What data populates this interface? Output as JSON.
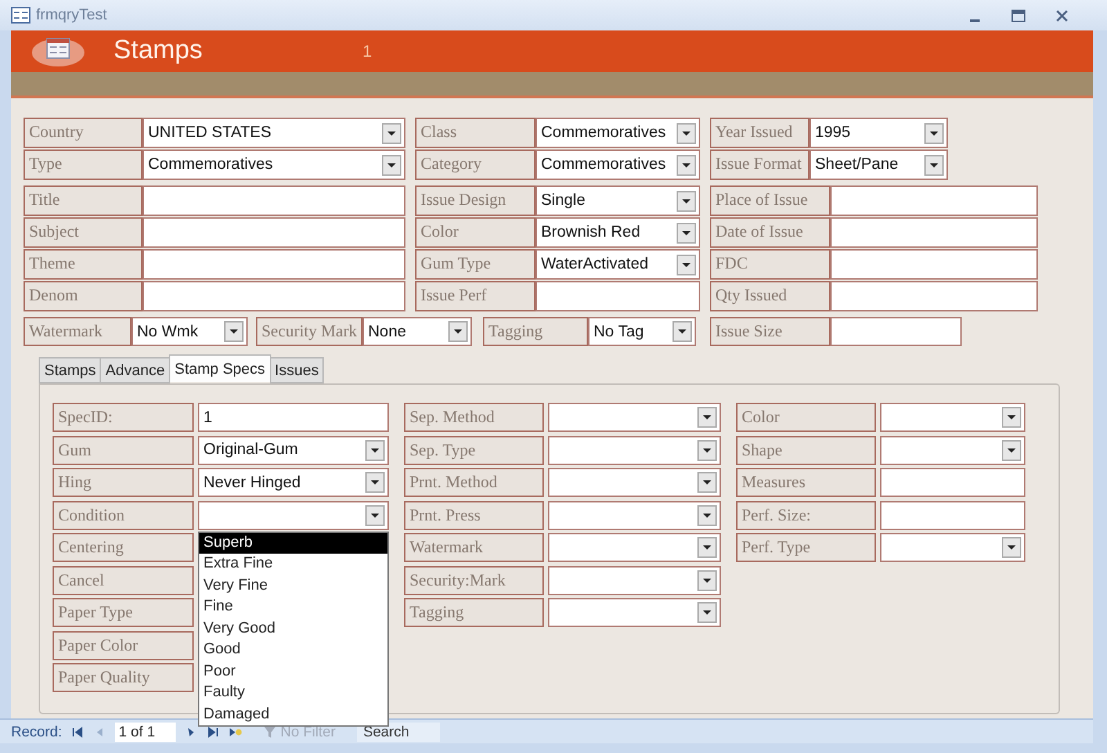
{
  "window": {
    "title": "frmqryTest"
  },
  "header": {
    "title": "Stamps",
    "record_number": "1"
  },
  "top_rows": [
    {
      "fields": [
        {
          "label": "Country",
          "value": "UNITED STATES",
          "kind": "combo"
        },
        {
          "label": "Class",
          "value": "Commemoratives",
          "kind": "combo"
        },
        {
          "label": "Year Issued",
          "value": "1995",
          "kind": "combo"
        }
      ]
    },
    {
      "fields": [
        {
          "label": "Type",
          "value": "Commemoratives",
          "kind": "combo"
        },
        {
          "label": "Category",
          "value": "Commemoratives",
          "kind": "combo"
        },
        {
          "label": "Issue Format",
          "value": "Sheet/Pane",
          "kind": "combo"
        }
      ]
    }
  ],
  "mid_rows": [
    {
      "fields": [
        {
          "label": "Title",
          "kind": "text"
        },
        {
          "label": "Issue Design",
          "value": "Single",
          "kind": "combo"
        },
        {
          "label": "Place of Issue",
          "kind": "text"
        }
      ]
    },
    {
      "fields": [
        {
          "label": "Subject",
          "kind": "text"
        },
        {
          "label": "Color",
          "value": "Brownish Red",
          "kind": "combo"
        },
        {
          "label": "Date of Issue",
          "kind": "text"
        }
      ]
    },
    {
      "fields": [
        {
          "label": "Theme",
          "kind": "text"
        },
        {
          "label": "Gum Type",
          "value": "WaterActivated",
          "kind": "combo"
        },
        {
          "label": "FDC",
          "kind": "text"
        }
      ]
    },
    {
      "fields": [
        {
          "label": "Denom",
          "kind": "text"
        },
        {
          "label": "Issue Perf",
          "kind": "text"
        },
        {
          "label": "Qty Issued",
          "kind": "text"
        }
      ]
    }
  ],
  "bottom_row": [
    {
      "label": "Watermark",
      "value": "No Wmk",
      "kind": "combo"
    },
    {
      "label": "Security Mark",
      "value": "None",
      "kind": "combo"
    },
    {
      "label": "Tagging",
      "value": "No Tag",
      "kind": "combo"
    },
    {
      "label": "Issue Size",
      "kind": "text"
    }
  ],
  "tabs": [
    {
      "label": "Stamps",
      "selected": false
    },
    {
      "label": "Advance",
      "selected": false
    },
    {
      "label": "Stamp Specs",
      "selected": true
    },
    {
      "label": "Issues",
      "selected": false
    }
  ],
  "spec_columns": [
    {
      "fields": [
        {
          "label": "SpecID:",
          "value": "1",
          "kind": "text"
        },
        {
          "label": "Gum",
          "value": "Original-Gum",
          "kind": "combo"
        },
        {
          "label": "Hing",
          "value": "Never Hinged",
          "kind": "combo"
        },
        {
          "label": "Condition",
          "kind": "combo",
          "open": true,
          "options": [
            {
              "label": "Superb",
              "selected": true
            },
            {
              "label": "Extra Fine",
              "selected": false
            },
            {
              "label": "Very Fine",
              "selected": false
            },
            {
              "label": "Fine",
              "selected": false
            },
            {
              "label": "Very Good",
              "selected": false
            },
            {
              "label": "Good",
              "selected": false
            },
            {
              "label": "Poor",
              "selected": false
            },
            {
              "label": "Faulty",
              "selected": false
            },
            {
              "label": "Damaged",
              "selected": false
            }
          ]
        },
        {
          "label": "Centering"
        },
        {
          "label": "Cancel"
        },
        {
          "label": "Paper Type"
        },
        {
          "label": "Paper Color"
        },
        {
          "label": "Paper Quality"
        }
      ]
    },
    {
      "fields": [
        {
          "label": "Sep. Method",
          "kind": "combo"
        },
        {
          "label": "Sep. Type",
          "kind": "combo"
        },
        {
          "label": "Prnt. Method",
          "kind": "combo"
        },
        {
          "label": "Prnt. Press",
          "kind": "combo"
        },
        {
          "label": "Watermark",
          "kind": "combo"
        },
        {
          "label": "Security:Mark",
          "kind": "combo"
        },
        {
          "label": "Tagging",
          "kind": "combo"
        }
      ]
    },
    {
      "fields": [
        {
          "label": "Color",
          "kind": "combo"
        },
        {
          "label": "Shape",
          "kind": "combo"
        },
        {
          "label": "Measures",
          "kind": "text"
        },
        {
          "label": "Perf. Size:",
          "kind": "text"
        },
        {
          "label": "Perf. Type",
          "kind": "combo"
        }
      ]
    }
  ],
  "status_bar": {
    "record_label": "Record:",
    "position": "1 of 1",
    "filter": "No Filter",
    "search": "Search"
  }
}
